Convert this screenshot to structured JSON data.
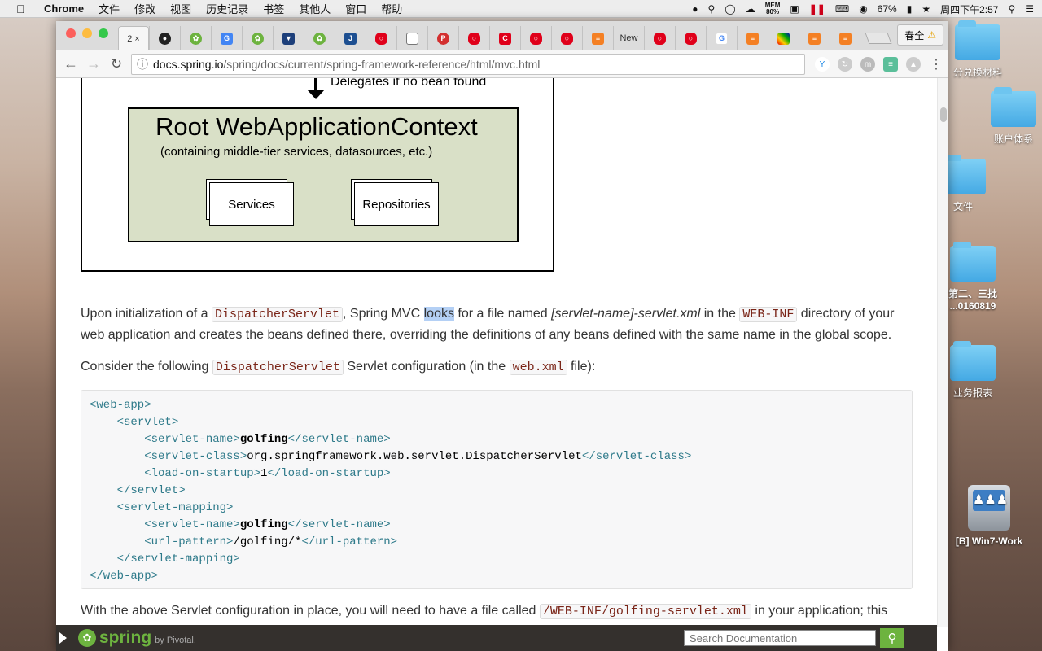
{
  "menubar": {
    "apple": "",
    "app_name": "Chrome",
    "items": [
      "文件",
      "修改",
      "视图",
      "历史记录",
      "书签",
      "其他人",
      "窗口",
      "帮助"
    ],
    "mem_label": "MEM",
    "mem_value": "80%",
    "battery": "67%",
    "clock": "周四下午2:57"
  },
  "desktop": {
    "icons": [
      {
        "label": "分兑换材料"
      },
      {
        "label": "账户体系"
      },
      {
        "label": "文件"
      },
      {
        "label": "第二、三批\n...0160819"
      },
      {
        "label": "业务报表"
      },
      {
        "label": "[B] Win7-Work"
      }
    ]
  },
  "browser": {
    "active_tab_title": "2",
    "tab_new_title": "New",
    "profile_label": "春全",
    "url_domain": "docs.spring.io",
    "url_path": "/spring/docs/current/spring-framework-reference/html/mvc.html"
  },
  "diagram": {
    "delegate_label": "Delegates if no bean found",
    "root_title": "Root WebApplicationContext",
    "root_subtitle": "(containing middle-tier services, datasources, etc.)",
    "services_label": "Services",
    "repositories_label": "Repositories"
  },
  "content": {
    "p1_a": "Upon initialization of a ",
    "p1_code1": "DispatcherServlet",
    "p1_b": ", Spring MVC ",
    "p1_hl": "looks",
    "p1_c": " for a file named ",
    "p1_em": "[servlet-name]-servlet.xml",
    "p1_d": " in the ",
    "p1_code2": "WEB-INF",
    "p1_e": " directory of your web application and creates the beans defined there, overriding the definitions of any beans defined with the same name in the global scope.",
    "p2_a": "Consider the following ",
    "p2_code1": "DispatcherServlet",
    "p2_b": " Servlet configuration (in the ",
    "p2_code2": "web.xml",
    "p2_c": " file):",
    "p3_a": "With the above Servlet configuration in place, you will need to have a file called ",
    "p3_code": "/WEB-INF/golfing-servlet.xml",
    "p3_b": " in your application; this"
  },
  "code": {
    "l1": "<web-app>",
    "l2_open": "<servlet>",
    "l3_open": "<servlet-name>",
    "l3_val": "golfing",
    "l3_close": "</servlet-name>",
    "l4_open": "<servlet-class>",
    "l4_val": "org.springframework.web.servlet.DispatcherServlet",
    "l4_close": "</servlet-class>",
    "l5_open": "<load-on-startup>",
    "l5_val": "1",
    "l5_close": "</load-on-startup>",
    "l6": "</servlet>",
    "l7": "<servlet-mapping>",
    "l8_open": "<servlet-name>",
    "l8_val": "golfing",
    "l8_close": "</servlet-name>",
    "l9_open": "<url-pattern>",
    "l9_val": "/golfing/*",
    "l9_close": "</url-pattern>",
    "l10": "</servlet-mapping>",
    "l11": "</web-app>"
  },
  "springbar": {
    "logo_word": "spring",
    "by_pivotal": "by Pivotal.",
    "search_placeholder": "Search Documentation"
  }
}
